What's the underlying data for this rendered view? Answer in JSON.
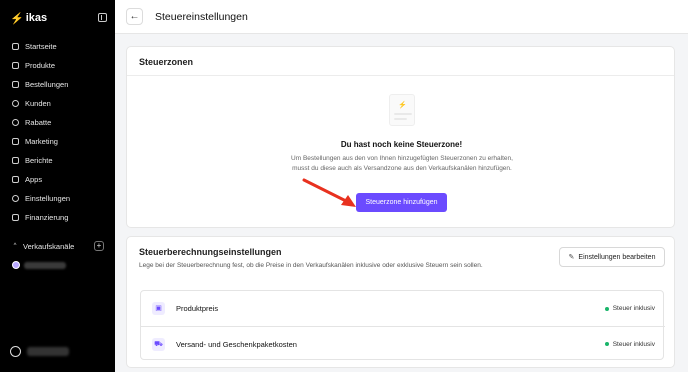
{
  "app": {
    "brand": "ikas"
  },
  "sidebar": {
    "items": [
      {
        "label": "Startseite",
        "icon": "home-icon"
      },
      {
        "label": "Produkte",
        "icon": "box-icon"
      },
      {
        "label": "Bestellungen",
        "icon": "cart-icon"
      },
      {
        "label": "Kunden",
        "icon": "users-icon"
      },
      {
        "label": "Rabatte",
        "icon": "discount-icon"
      },
      {
        "label": "Marketing",
        "icon": "megaphone-icon"
      },
      {
        "label": "Berichte",
        "icon": "chart-icon"
      },
      {
        "label": "Apps",
        "icon": "apps-icon"
      },
      {
        "label": "Einstellungen",
        "icon": "gear-icon"
      },
      {
        "label": "Finanzierung",
        "icon": "wallet-icon"
      }
    ],
    "channels_label": "Verkaufskanäle"
  },
  "header": {
    "title": "Steuereinstellungen"
  },
  "tax_zones": {
    "title": "Steuerzonen",
    "empty_title": "Du hast noch keine Steuerzone!",
    "empty_desc": "Um Bestellungen aus den von Ihnen hinzugefügten Steuerzonen zu erhalten, musst du diese auch als Versandzone aus den Verkaufskanälen hinzufügen.",
    "add_button": "Steuerzone hinzufügen"
  },
  "tax_calc": {
    "title": "Steuerberechnungseinstellungen",
    "desc": "Lege bei der Steuerberechnung fest, ob die Preise in den Verkaufskanälen inklusive oder exklusive Steuern sein sollen.",
    "edit_button": "Einstellungen bearbeiten",
    "rows": [
      {
        "label": "Produktpreis",
        "status": "Steuer inklusiv"
      },
      {
        "label": "Versand- und Geschenkpaketkosten",
        "status": "Steuer inklusiv"
      }
    ]
  },
  "colors": {
    "accent": "#6b4bff",
    "status_green": "#19b56a",
    "annotation_red": "#e8311f"
  }
}
